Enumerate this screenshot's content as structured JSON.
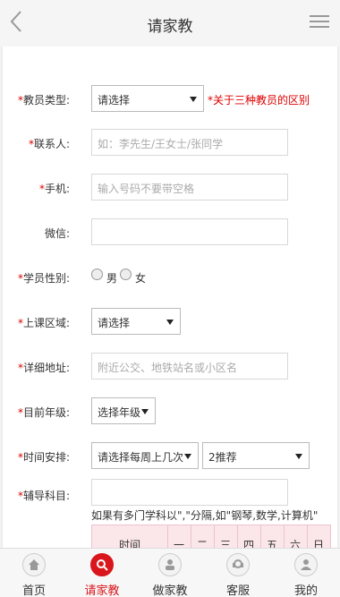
{
  "header": {
    "title": "请家教"
  },
  "form": {
    "teacher_type": {
      "label": "教员类型:",
      "value": "请选择",
      "note": "*关于三种教员的区别"
    },
    "contact": {
      "label": "联系人:",
      "placeholder": "如：李先生/王女士/张同学"
    },
    "phone": {
      "label": "手机:",
      "placeholder": "输入号码不要带空格"
    },
    "wechat": {
      "label": "微信:"
    },
    "student_gender": {
      "label": "学员性别:",
      "options": [
        "男",
        "女"
      ]
    },
    "area": {
      "label": "上课区域:",
      "value": "请选择"
    },
    "address": {
      "label": "详细地址:",
      "placeholder": "附近公交、地铁站名或小区名"
    },
    "grade": {
      "label": "目前年级:",
      "value": "选择年级"
    },
    "schedule": {
      "label": "时间安排:",
      "times_value": "请选择每周上几次",
      "count_value": "2推荐"
    },
    "subject": {
      "label": "辅导科目:",
      "hint": "如果有多门学科以\",\"分隔,如\"钢琴,数学,计算机\""
    },
    "timetable": {
      "header": [
        "时间",
        "一",
        "二",
        "三",
        "四",
        "五",
        "六",
        "日"
      ]
    }
  },
  "tabbar": [
    {
      "label": "首页",
      "icon": "home-icon",
      "active": false
    },
    {
      "label": "请家教",
      "icon": "search-teacher-icon",
      "active": true
    },
    {
      "label": "做家教",
      "icon": "teach-icon",
      "active": false
    },
    {
      "label": "客服",
      "icon": "customer-service-icon",
      "active": false
    },
    {
      "label": "我的",
      "icon": "user-icon",
      "active": false
    }
  ],
  "colors": {
    "accent": "#d9161c",
    "required": "#dd0000",
    "timetable_bg": "#fbe6ea"
  }
}
